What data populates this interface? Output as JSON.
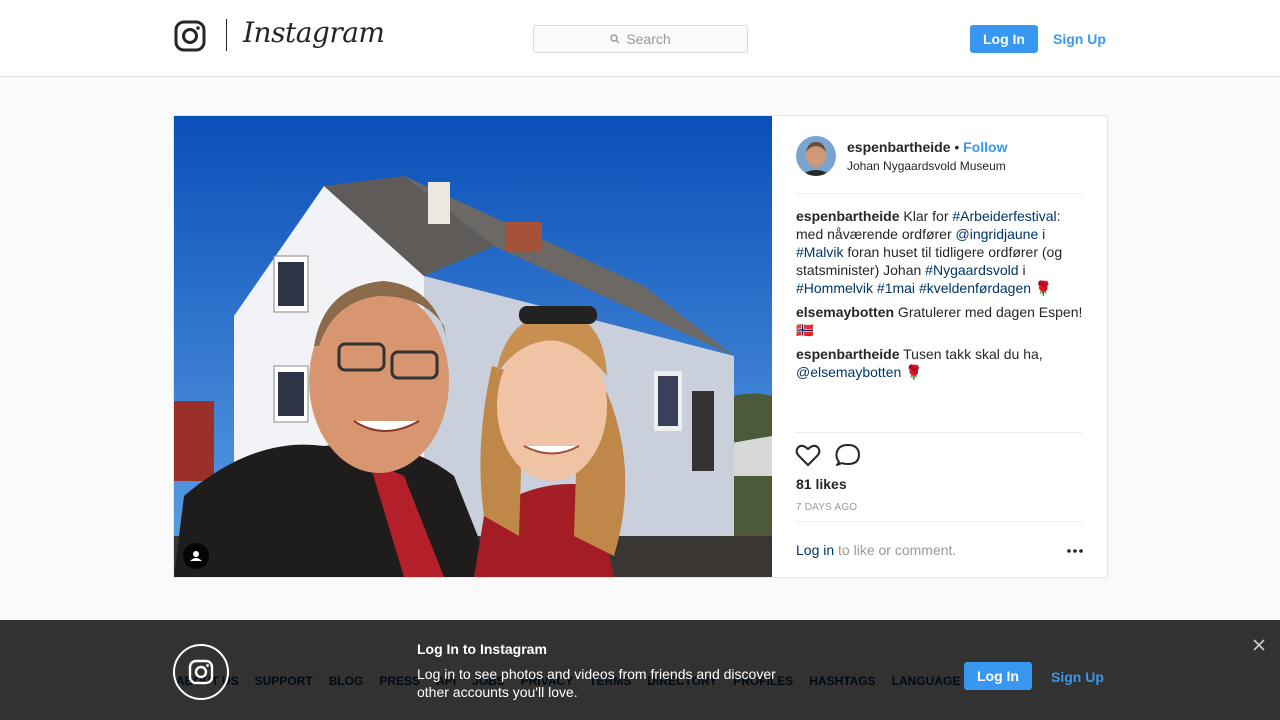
{
  "nav": {
    "wordmark": "Instagram",
    "search_placeholder": "Search",
    "login_label": "Log In",
    "signup_label": "Sign Up"
  },
  "post": {
    "username": "espenbartheide",
    "separator": "•",
    "follow_label": "Follow",
    "location": "Johan Nygaardsvold Museum",
    "comments": [
      {
        "user": "espenbartheide",
        "parts": [
          {
            "text": " Klar for ",
            "type": "text"
          },
          {
            "text": "#Arbeiderfestival",
            "type": "link"
          },
          {
            "text": ": med nåværende ordfører ",
            "type": "text"
          },
          {
            "text": "@ingridjaune",
            "type": "link"
          },
          {
            "text": " i ",
            "type": "text"
          },
          {
            "text": "#Malvik",
            "type": "link"
          },
          {
            "text": " foran huset til tidligere ordfører (og statsminister) Johan ",
            "type": "text"
          },
          {
            "text": "#Nygaardsvold",
            "type": "link"
          },
          {
            "text": " i ",
            "type": "text"
          },
          {
            "text": "#Hommelvik",
            "type": "link"
          },
          {
            "text": " ",
            "type": "text"
          },
          {
            "text": "#1mai",
            "type": "link"
          },
          {
            "text": " ",
            "type": "text"
          },
          {
            "text": "#kveldenførdagen",
            "type": "link"
          },
          {
            "text": " 🌹",
            "type": "text"
          }
        ]
      },
      {
        "user": "elsemaybotten",
        "parts": [
          {
            "text": " Gratulerer med dagen Espen! 🇳🇴",
            "type": "text"
          }
        ]
      },
      {
        "user": "espenbartheide",
        "parts": [
          {
            "text": " Tusen takk skal du ha, ",
            "type": "text"
          },
          {
            "text": "@elsemaybotten",
            "type": "link"
          },
          {
            "text": " 🌹",
            "type": "text"
          }
        ]
      }
    ],
    "likes": "81 likes",
    "time": "7 DAYS AGO",
    "login_link": "Log in",
    "login_rest": " to like or comment."
  },
  "footer": {
    "links": [
      "ABOUT US",
      "SUPPORT",
      "BLOG",
      "PRESS",
      "API",
      "JOBS",
      "PRIVACY",
      "TERMS",
      "DIRECTORY",
      "PROFILES",
      "HASHTAGS",
      "LANGUAGE"
    ]
  },
  "banner": {
    "title": "Log In to Instagram",
    "text": "Log in to see photos and videos from friends and discover other accounts you'll love.",
    "login_label": "Log In",
    "signup_label": "Sign Up"
  },
  "colors": {
    "accent": "#3897f0",
    "link": "#003569"
  }
}
